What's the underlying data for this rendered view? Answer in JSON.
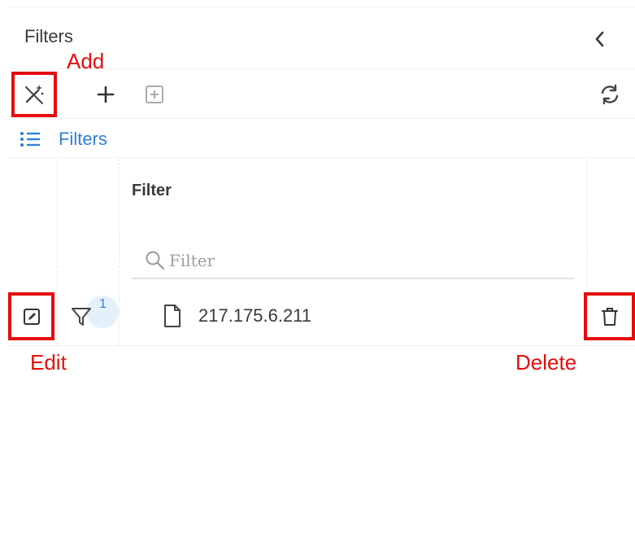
{
  "header": {
    "title": "Filters"
  },
  "toolbar": {
    "wand_icon": "magic-wand-icon",
    "plus_icon": "plus-icon",
    "plus_box_icon": "plus-square-icon",
    "refresh_icon": "refresh-icon"
  },
  "list_tab": {
    "icon": "list-icon",
    "label": "Filters"
  },
  "table": {
    "column_header": "Filter",
    "search_placeholder": "Filter",
    "rows": [
      {
        "badge_count": "1",
        "value": "217.175.6.211",
        "icon": "file-icon"
      }
    ]
  },
  "annotations": {
    "add": "Add",
    "edit": "Edit",
    "delete": "Delete"
  },
  "colors": {
    "accent": "#2f7fd8",
    "annotation": "#e50d0d",
    "badge_bg": "#e4f1fb"
  }
}
